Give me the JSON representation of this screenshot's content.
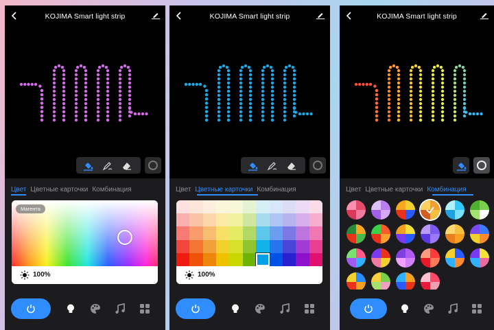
{
  "app": {
    "title": "KOJIMA  Smart light strip"
  },
  "tabs": [
    "Цвет",
    "Цветные карточки",
    "Комбинация"
  ],
  "screens": [
    {
      "active_tab": 0,
      "strip_color": "#d46be8",
      "preset_label": "Магента",
      "brightness": "100%"
    },
    {
      "active_tab": 1,
      "strip_color": "#1aa9e8",
      "brightness": "100%"
    },
    {
      "active_tab": 2,
      "strip_gradient": [
        "#ff4a3a",
        "#ff9a2a",
        "#f2e23a",
        "#e6f04a",
        "#2ab5ff"
      ]
    }
  ],
  "color_cards": {
    "columns": 11,
    "rows": [
      [
        "#fde0df",
        "#fde6d9",
        "#fdeedd",
        "#fdf5d9",
        "#f6f7d6",
        "#e6f2d4",
        "#d6eef6",
        "#d8e6fa",
        "#dcdcf6",
        "#eddaf4",
        "#fadbe8"
      ],
      [
        "#fbb0ad",
        "#fbc3a6",
        "#fbd7ab",
        "#fbeaa6",
        "#f0f2a2",
        "#cfe6a0",
        "#a7dcef",
        "#adc6f4",
        "#b5b4ee",
        "#d7b0ea",
        "#f6aecf"
      ],
      [
        "#f77a74",
        "#f79c6a",
        "#f7bd70",
        "#f7df68",
        "#e5eb63",
        "#b2d866",
        "#5ec7ec",
        "#6b9df0",
        "#7c79e4",
        "#bd74df",
        "#f077b1"
      ],
      [
        "#f2463c",
        "#f27533",
        "#f2a13a",
        "#f2d02e",
        "#d7e12b",
        "#8fc62f",
        "#14b2ea",
        "#2775ee",
        "#4a44d9",
        "#a23ad6",
        "#e83f92"
      ],
      [
        "#ef1a10",
        "#ef5208",
        "#ef860c",
        "#efc200",
        "#cbd800",
        "#6db404",
        "#00a0e8",
        "#0051e6",
        "#2a20cf",
        "#8c10cc",
        "#e0106f"
      ]
    ],
    "selected": [
      4,
      6
    ]
  },
  "combinations": [
    [
      "#e84a6a",
      "#f07aa0",
      "#d93a5a",
      "#ff8fb0"
    ],
    [
      "#b87ef0",
      "#d7a8f5",
      "#a060e8",
      "#e0c0f8"
    ],
    [
      "#f2d030",
      "#2a5bff",
      "#e8331a",
      "#f7a820"
    ],
    [
      "#f0a030",
      "#f4c040",
      "#d06020",
      "#ffd060"
    ],
    [
      "#30c8ff",
      "#7ae0ff",
      "#20a0e0",
      "#b0f0ff"
    ],
    [
      "#7ad04a",
      "#ffffff",
      "#a6e070",
      "#50b030"
    ],
    [
      "#f7a820",
      "#4ab84a",
      "#e8331a",
      "#2a8a3a"
    ],
    [
      "#ff5a2a",
      "#ffa030",
      "#e8331a",
      "#3ad04a"
    ],
    [
      "#f2e23a",
      "#2a5bff",
      "#7a3af0",
      "#f0a020"
    ],
    [
      "#7a5af0",
      "#9a7af8",
      "#5a3ae0",
      "#b89aff"
    ],
    [
      "#f5c040",
      "#f7a020",
      "#e88020",
      "#ffd870"
    ],
    [
      "#3a7aff",
      "#ff8a30",
      "#f2d030",
      "#7a4af0"
    ],
    [
      "#ff5a8a",
      "#30b0ff",
      "#a05af0",
      "#7ae070"
    ],
    [
      "#e8331a",
      "#f2d030",
      "#f07aa0",
      "#7a3af0"
    ],
    [
      "#b05af0",
      "#d080f8",
      "#f0a0ff",
      "#8040e0"
    ],
    [
      "#ff3a3a",
      "#ff7a5a",
      "#e81a2a",
      "#ff9a80"
    ],
    [
      "#2a5bff",
      "#ff8a30",
      "#30b0ff",
      "#f2d030"
    ],
    [
      "#f2e23a",
      "#e86aa0",
      "#30b0ff",
      "#7a3af0"
    ],
    [
      "#2a8aff",
      "#f7a020",
      "#e8331a",
      "#f2d030"
    ],
    [
      "#7ad04a",
      "#f0a0c0",
      "#a6e070",
      "#f7d040"
    ],
    [
      "#f7a020",
      "#e8331a",
      "#2a5bff",
      "#30b0ff"
    ],
    [
      "#ff4a6a",
      "#f0a0b0",
      "#e81a3a",
      "#ffc0d0"
    ]
  ],
  "combination_selected": 3,
  "colors": {
    "accent": "#2f8dff",
    "panel": "#1c1c1e",
    "toolbar": "#2a2a2d"
  },
  "icons": {
    "tools": [
      "paint-bucket-icon",
      "pen-icon",
      "eraser-icon"
    ],
    "nav": [
      "power-icon",
      "bulb-icon",
      "palette-icon",
      "music-icon",
      "grid-icon"
    ]
  }
}
